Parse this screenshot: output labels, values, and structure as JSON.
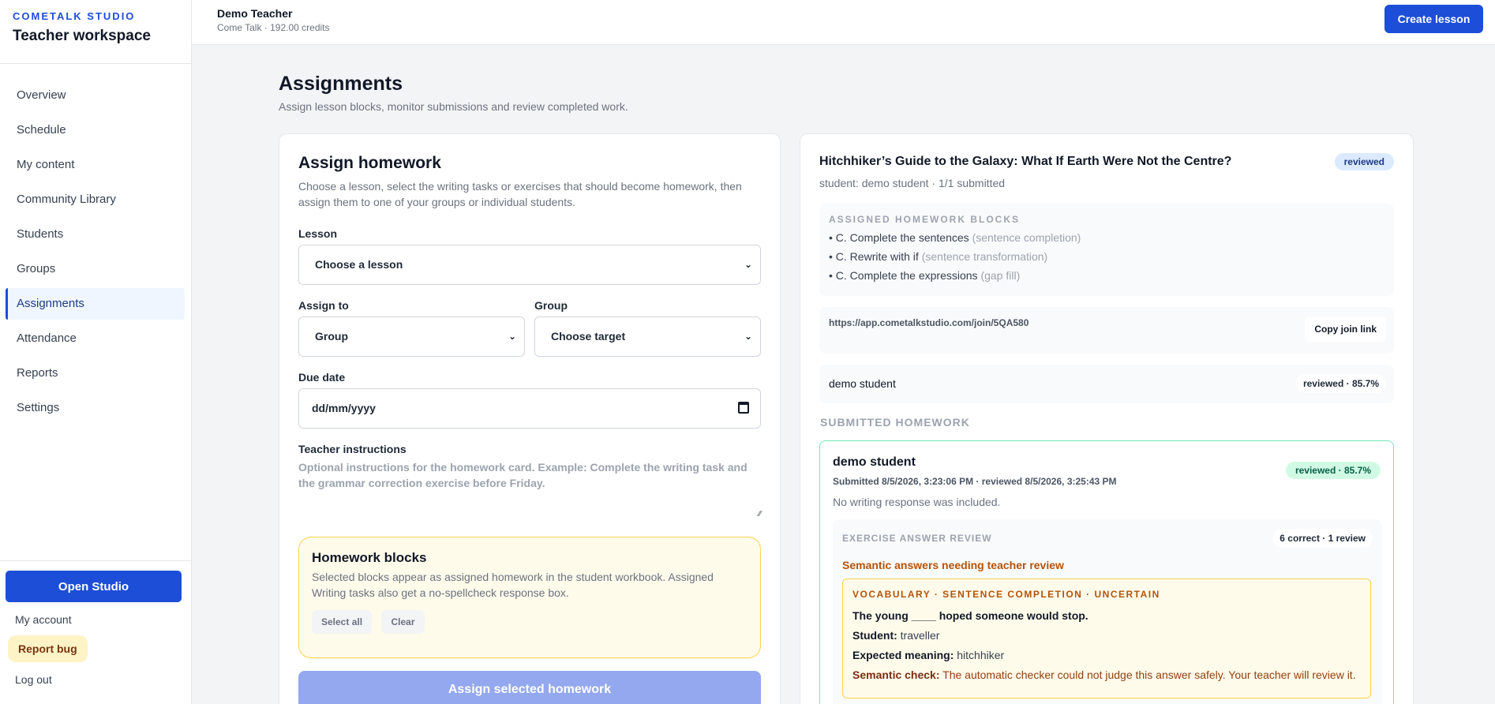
{
  "sidebar": {
    "brand_kicker": "COMETALK STUDIO",
    "brand_title": "Teacher workspace",
    "items": [
      {
        "label": "Overview"
      },
      {
        "label": "Schedule"
      },
      {
        "label": "My content"
      },
      {
        "label": "Community Library"
      },
      {
        "label": "Students"
      },
      {
        "label": "Groups"
      },
      {
        "label": "Assignments",
        "active": true
      },
      {
        "label": "Attendance"
      },
      {
        "label": "Reports"
      },
      {
        "label": "Settings"
      }
    ],
    "open_studio": "Open Studio",
    "my_account": "My account",
    "report_bug": "Report bug",
    "log_out": "Log out"
  },
  "topbar": {
    "user_name": "Demo Teacher",
    "user_sub": "Come Talk · 192.00 credits",
    "create_lesson": "Create lesson"
  },
  "page": {
    "title": "Assignments",
    "subtitle": "Assign lesson blocks, monitor submissions and review completed work."
  },
  "assign_form": {
    "title": "Assign homework",
    "description": "Choose a lesson, select the writing tasks or exercises that should become homework, then assign them to one of your groups or individual students.",
    "lesson_label": "Lesson",
    "lesson_value": "Choose a lesson",
    "assign_to_label": "Assign to",
    "assign_to_value": "Group",
    "group_label": "Group",
    "group_value": "Choose target",
    "due_label": "Due date",
    "due_value": "dd/mm/yyyy",
    "instructions_label": "Teacher instructions",
    "instructions_placeholder": "Optional instructions for the homework card. Example: Complete the writing task and the grammar correction exercise before Friday.",
    "blocks_title": "Homework blocks",
    "blocks_desc": "Selected blocks appear as assigned homework in the student workbook. Assigned Writing tasks also get a no-spellcheck response box.",
    "select_all": "Select all",
    "clear": "Clear",
    "submit": "Assign selected homework"
  },
  "assignment": {
    "title": "Hitchhiker’s Guide to the Galaxy: What If Earth Were Not the Centre?",
    "status": "reviewed",
    "subtitle": "student: demo student · 1/1 submitted",
    "blocks_kicker": "ASSIGNED HOMEWORK BLOCKS",
    "blocks": [
      {
        "name": "• C. Complete the sentences",
        "type": "(sentence completion)"
      },
      {
        "name": "• C. Rewrite with if",
        "type": "(sentence transformation)"
      },
      {
        "name": "• C. Complete the expressions",
        "type": "(gap fill)"
      }
    ],
    "join_url": "https://app.cometalkstudio.com/join/5QA580",
    "copy_link": "Copy join link",
    "student_row": {
      "name": "demo student",
      "status": "reviewed · 85.7%"
    },
    "submitted_head": "SUBMITTED HOMEWORK",
    "submission": {
      "name": "demo student",
      "badge": "reviewed · 85.7%",
      "meta": "Submitted 8/5/2026, 3:23:06 PM · reviewed 8/5/2026, 3:25:43 PM",
      "note": "No writing response was included.",
      "review_kicker": "EXERCISE ANSWER REVIEW",
      "review_count": "6 correct · 1 review",
      "semantic_head": "Semantic answers needing teacher review",
      "item": {
        "kicker": "VOCABULARY · SENTENCE COMPLETION · UNCERTAIN",
        "question": "The young ____ hoped someone would stop.",
        "student_label": "Student:",
        "student_value": "traveller",
        "expected_label": "Expected meaning:",
        "expected_value": "hitchhiker",
        "check_label": "Semantic check:",
        "check_value": "The automatic checker could not judge this answer safely. Your teacher will review it."
      }
    }
  }
}
